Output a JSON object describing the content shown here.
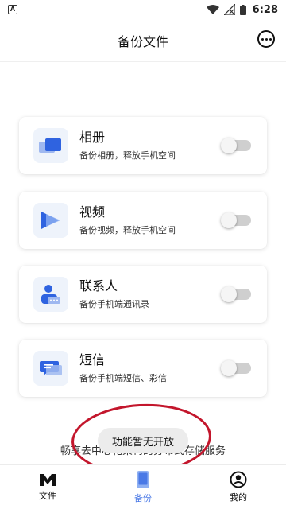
{
  "status_bar": {
    "time": "6:28",
    "notification_icon": "A"
  },
  "header": {
    "title": "备份文件",
    "more_icon": "more-icon"
  },
  "items": [
    {
      "title": "相册",
      "desc": "备份相册，释放手机空间",
      "icon": "photo-icon",
      "enabled": false
    },
    {
      "title": "视频",
      "desc": "备份视频，释放手机空间",
      "icon": "video-icon",
      "enabled": false
    },
    {
      "title": "联系人",
      "desc": "备份手机端通讯录",
      "icon": "contacts-icon",
      "enabled": false
    },
    {
      "title": "短信",
      "desc": "备份手机端短信、彩信",
      "icon": "sms-icon",
      "enabled": false
    }
  ],
  "footer_text": "畅享去中心化架构的分布式存储服务",
  "toast": "功能暂无开放",
  "nav": [
    {
      "label": "文件",
      "icon": "logo-icon",
      "active": false
    },
    {
      "label": "备份",
      "icon": "phone-icon",
      "active": true
    },
    {
      "label": "我的",
      "icon": "user-icon",
      "active": false
    }
  ],
  "colors": {
    "accent": "#4a79e6",
    "icon_blue": "#3d6fe0",
    "annotation": "#c3162c"
  }
}
